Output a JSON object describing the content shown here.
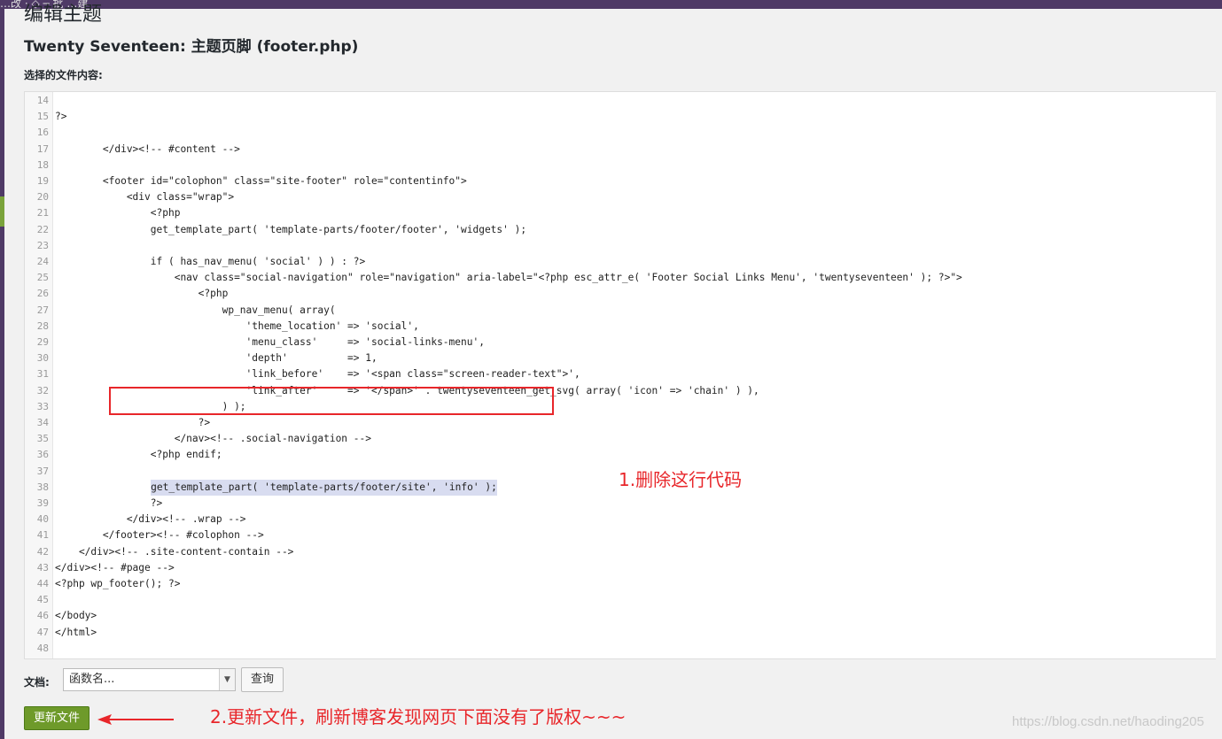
{
  "topbar": {
    "crumb": "…改 · ◇ ─ 批 …建"
  },
  "page": {
    "title": "编辑主题",
    "file_title": "Twenty Seventeen: 主题页脚 (footer.php)",
    "selected_label": "选择的文件内容:"
  },
  "editor": {
    "lines": [
      {
        "n": "14",
        "code": ""
      },
      {
        "n": "15",
        "code": "?>"
      },
      {
        "n": "16",
        "code": ""
      },
      {
        "n": "17",
        "code": "        </div><!-- #content -->"
      },
      {
        "n": "18",
        "code": ""
      },
      {
        "n": "19",
        "code": "        <footer id=\"colophon\" class=\"site-footer\" role=\"contentinfo\">"
      },
      {
        "n": "20",
        "code": "            <div class=\"wrap\">"
      },
      {
        "n": "21",
        "code": "                <?php"
      },
      {
        "n": "22",
        "code": "                get_template_part( 'template-parts/footer/footer', 'widgets' );"
      },
      {
        "n": "23",
        "code": ""
      },
      {
        "n": "24",
        "code": "                if ( has_nav_menu( 'social' ) ) : ?>"
      },
      {
        "n": "25",
        "code": "                    <nav class=\"social-navigation\" role=\"navigation\" aria-label=\"<?php esc_attr_e( 'Footer Social Links Menu', 'twentyseventeen' ); ?>\">"
      },
      {
        "n": "26",
        "code": "                        <?php"
      },
      {
        "n": "27",
        "code": "                            wp_nav_menu( array("
      },
      {
        "n": "28",
        "code": "                                'theme_location' => 'social',"
      },
      {
        "n": "29",
        "code": "                                'menu_class'     => 'social-links-menu',"
      },
      {
        "n": "30",
        "code": "                                'depth'          => 1,"
      },
      {
        "n": "31",
        "code": "                                'link_before'    => '<span class=\"screen-reader-text\">',"
      },
      {
        "n": "32",
        "code": "                                'link_after'     => '</span>' . twentyseventeen_get_svg( array( 'icon' => 'chain' ) ),"
      },
      {
        "n": "33",
        "code": "                            ) );"
      },
      {
        "n": "34",
        "code": "                        ?>"
      },
      {
        "n": "35",
        "code": "                    </nav><!-- .social-navigation -->"
      },
      {
        "n": "36",
        "code": "                <?php endif;"
      },
      {
        "n": "37",
        "code": ""
      },
      {
        "n": "38",
        "code": "get_template_part( 'template-parts/footer/site', 'info' );",
        "indent": "                ",
        "highlight": true
      },
      {
        "n": "39",
        "code": "                ?>"
      },
      {
        "n": "40",
        "code": "            </div><!-- .wrap -->"
      },
      {
        "n": "41",
        "code": "        </footer><!-- #colophon -->"
      },
      {
        "n": "42",
        "code": "    </div><!-- .site-content-contain -->"
      },
      {
        "n": "43",
        "code": "</div><!-- #page -->"
      },
      {
        "n": "44",
        "code": "<?php wp_footer(); ?>"
      },
      {
        "n": "45",
        "code": ""
      },
      {
        "n": "46",
        "code": "</body>"
      },
      {
        "n": "47",
        "code": "</html>"
      },
      {
        "n": "48",
        "code": ""
      }
    ]
  },
  "annotations": {
    "step1": "1.删除这行代码",
    "step2": "2.更新文件，刷新博客发现网页下面没有了版权~~~"
  },
  "docs": {
    "label": "文档:",
    "select_value": "函数名...",
    "query_button": "查询"
  },
  "update_button": "更新文件",
  "watermark": "https://blog.csdn.net/haoding205",
  "colors": {
    "admin_bar": "#4f3a66",
    "update_button": "#6e9a2a",
    "annotation_red": "#e8262a",
    "selection": "#d8dcf0"
  }
}
